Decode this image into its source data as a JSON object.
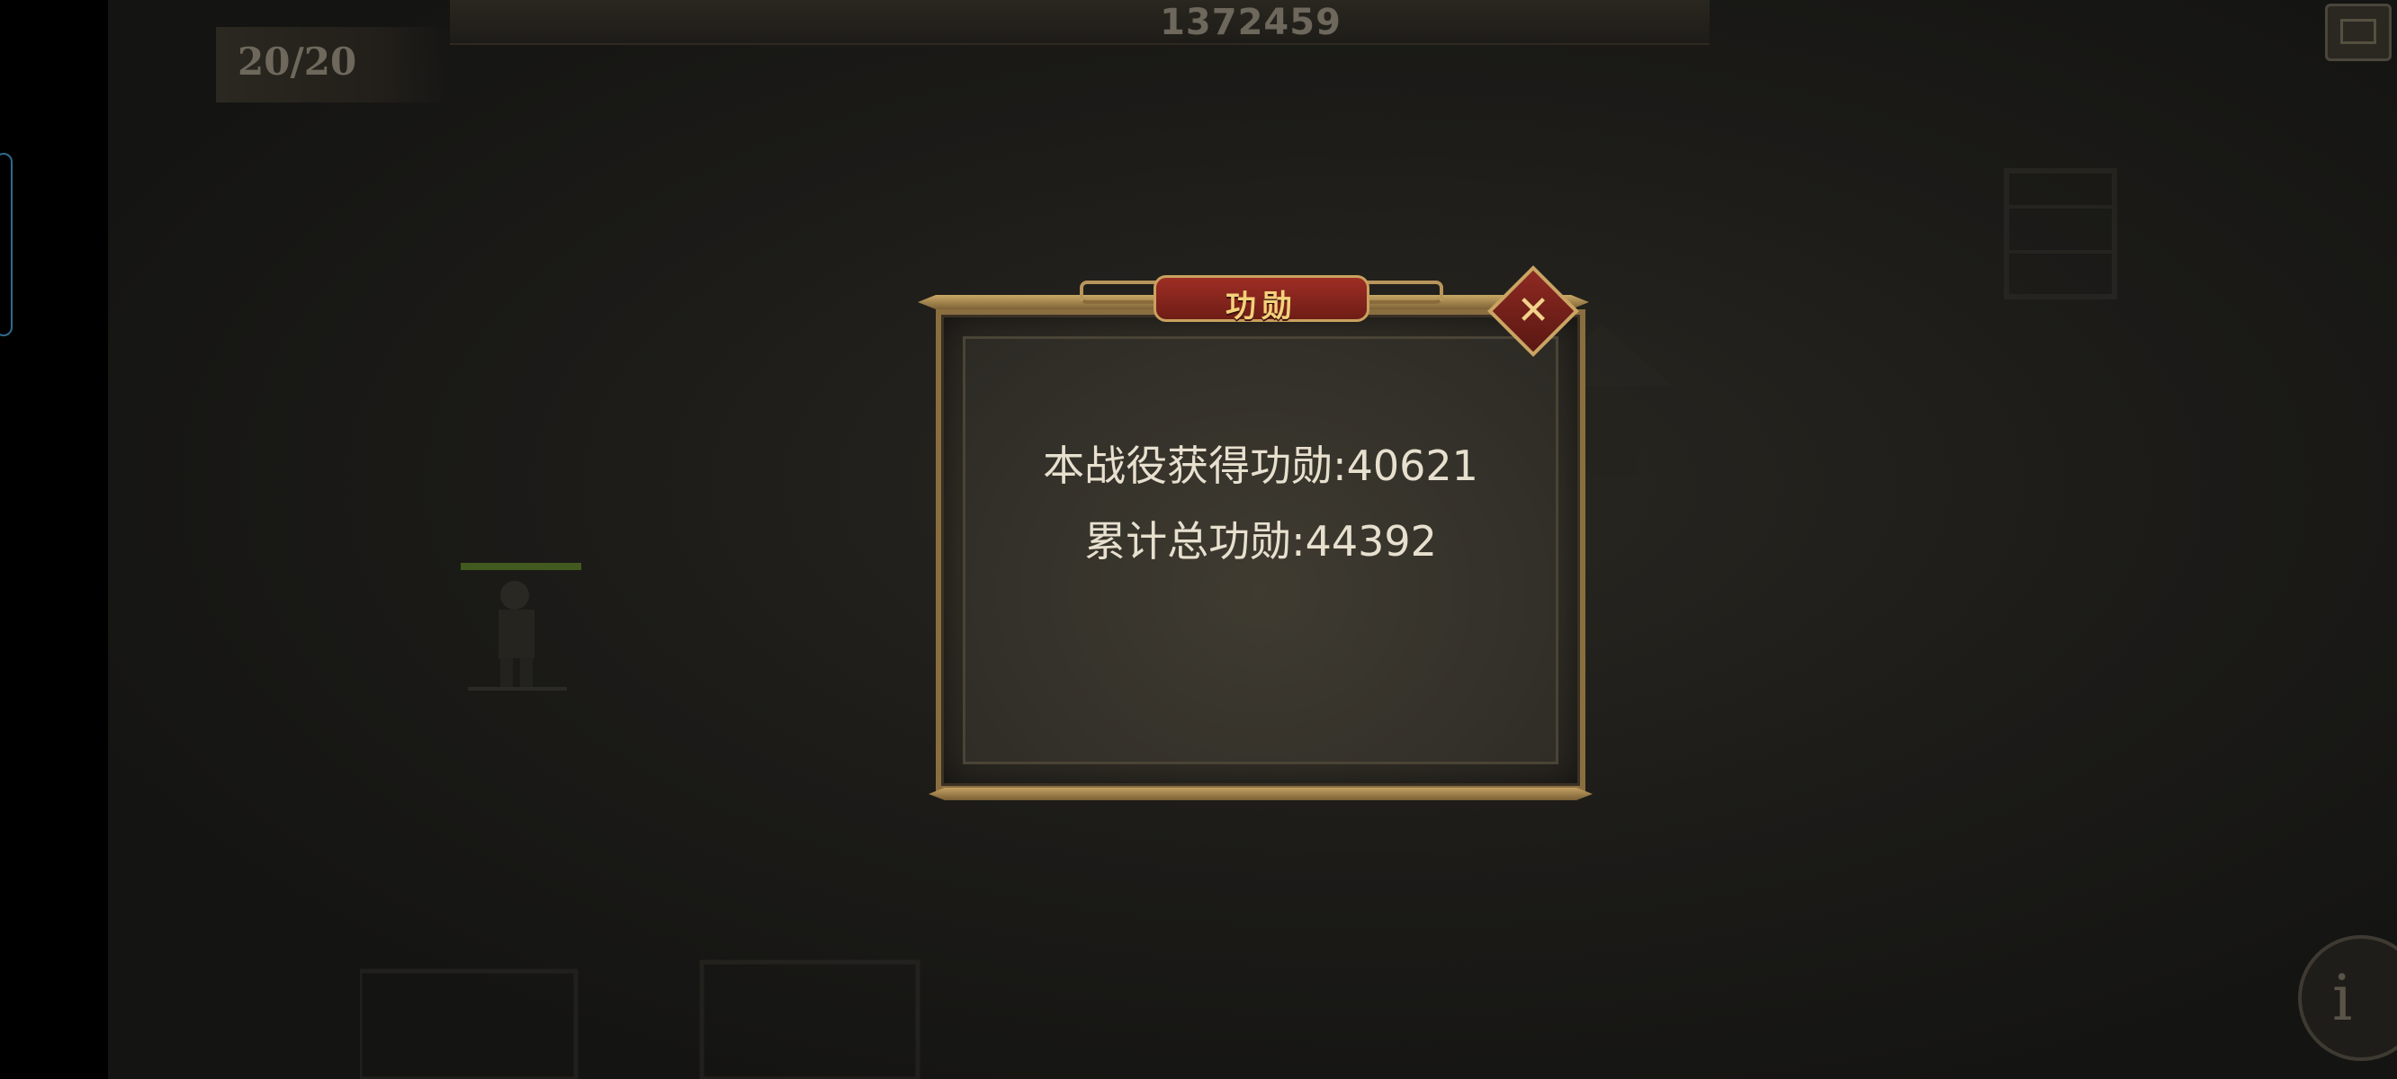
{
  "hud": {
    "score": "1372459",
    "troop_count": "20/20"
  },
  "dialog": {
    "title": "功勋",
    "line_1": "本战役获得功勋:40621",
    "line_2": "累计总功勋:44392",
    "close_icon": "close-x-icon"
  },
  "colors": {
    "accent_gold": "#c9a865",
    "title_red": "#8e2a22",
    "text_light": "#e8e0cf"
  }
}
